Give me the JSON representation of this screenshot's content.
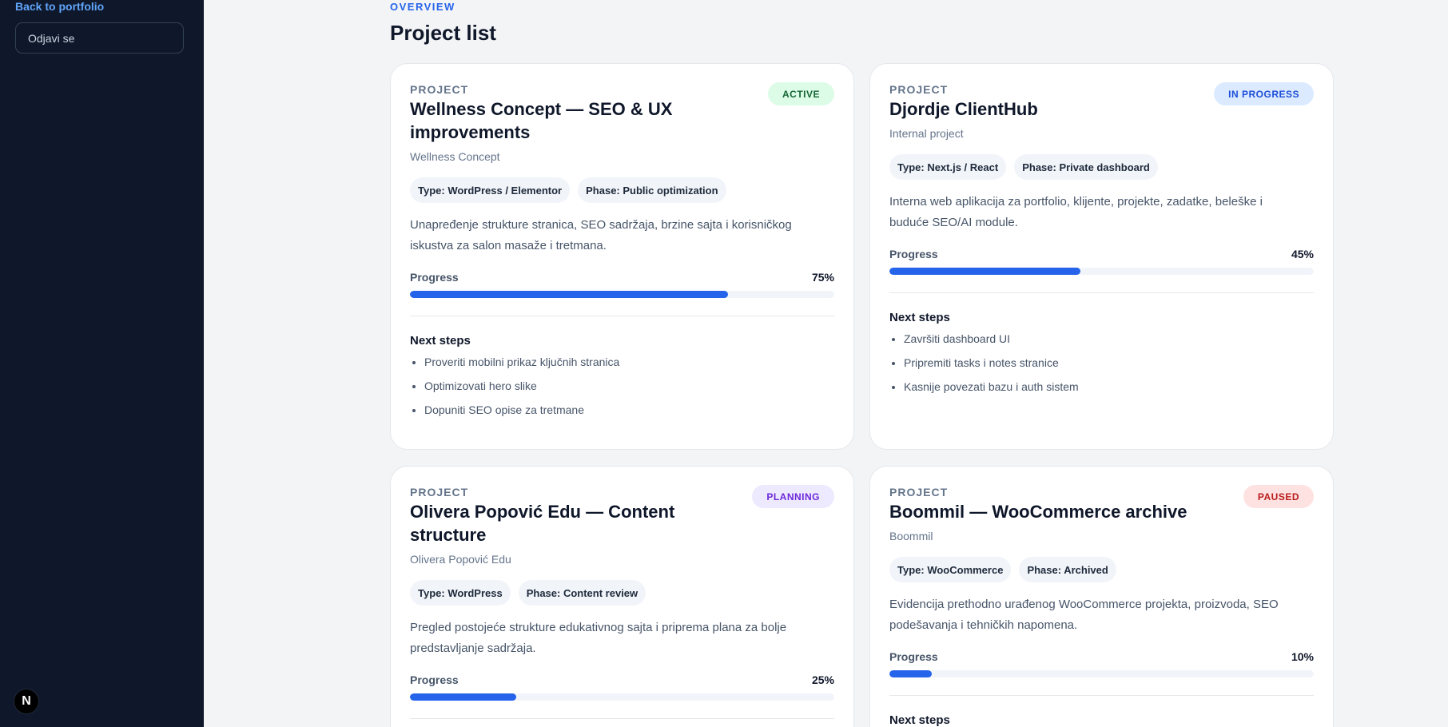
{
  "sidebar": {
    "back_link": "Back to portfolio",
    "logout_label": "Odjavi se",
    "badge_letter": "N"
  },
  "header": {
    "eyebrow": "OVERVIEW",
    "title": "Project list"
  },
  "progress_label": "Progress",
  "next_steps_label": "Next steps",
  "projects": [
    {
      "label": "PROJECT",
      "title": "Wellness Concept — SEO & UX improvements",
      "client": "Wellness Concept",
      "status": "ACTIVE",
      "status_color": "#dcfce7",
      "type": "Type: WordPress / Elementor",
      "phase": "Phase: Public optimization",
      "description": "Unapređenje strukture stranica, SEO sadržaja, brzine sajta i korisničkog iskustva za salon masaže i tretmana.",
      "progress": "75%",
      "progress_fraction": 0.75,
      "steps": [
        "Proveriti mobilni prikaz ključnih stranica",
        "Optimizovati hero slike",
        "Dopuniti SEO opise za tretmane"
      ]
    },
    {
      "label": "PROJECT",
      "title": "Djordje ClientHub",
      "client": "Internal project",
      "status": "IN PROGRESS",
      "status_color": "#dbeafe",
      "type": "Type: Next.js / React",
      "phase": "Phase: Private dashboard",
      "description": "Interna web aplikacija za portfolio, klijente, projekte, zadatke, beleške i buduće SEO/AI module.",
      "progress": "45%",
      "progress_fraction": 0.45,
      "steps": [
        "Završiti dashboard UI",
        "Pripremiti tasks i notes stranice",
        "Kasnije povezati bazu i auth sistem"
      ]
    },
    {
      "label": "PROJECT",
      "title": "Olivera Popović Edu — Content structure",
      "client": "Olivera Popović Edu",
      "status": "PLANNING",
      "status_color": "#ede9fe",
      "type": "Type: WordPress",
      "phase": "Phase: Content review",
      "description": "Pregled postojeće strukture edukativnog sajta i priprema plana za bolje predstavljanje sadržaja.",
      "progress": "25%",
      "progress_fraction": 0.25
    },
    {
      "label": "PROJECT",
      "title": "Boommil — WooCommerce archive",
      "client": "Boommil",
      "status": "PAUSED",
      "status_color": "#fee2e2",
      "type": "Type: WooCommerce",
      "phase": "Phase: Archived",
      "description": "Evidencija prethodno urađenog WooCommerce projekta, proizvoda, SEO podešavanja i tehničkih napomena.",
      "progress": "10%",
      "progress_fraction": 0.1
    }
  ]
}
